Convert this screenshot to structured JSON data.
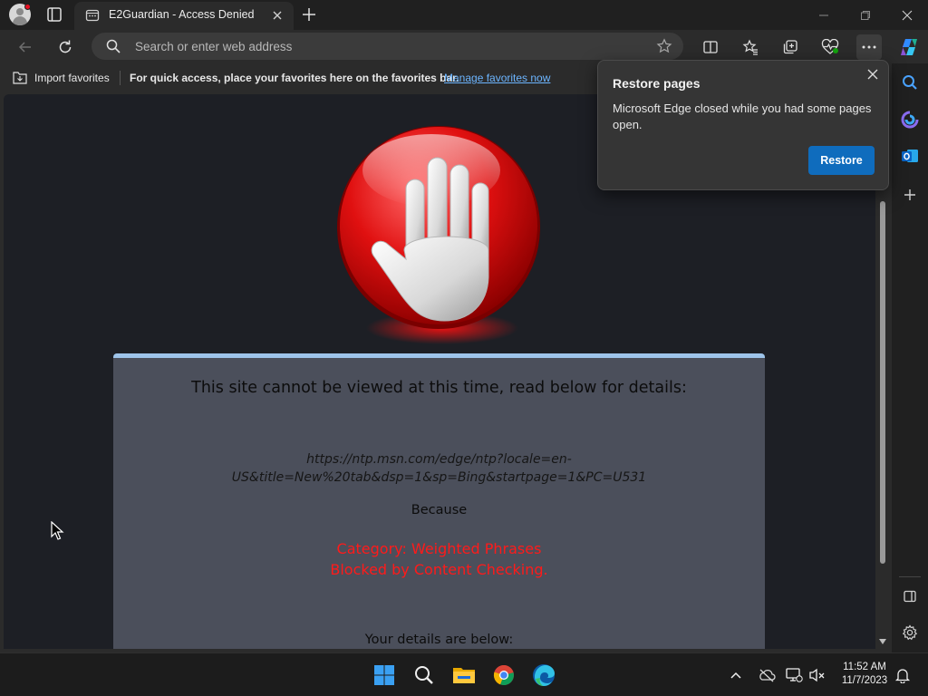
{
  "browser": {
    "tab_title": "E2Guardian - Access Denied",
    "address_placeholder": "Search or enter web address",
    "favorites_bar": {
      "import_label": "Import favorites",
      "hint_text": "For quick access, place your favorites here on the favorites bar.",
      "manage_link": "Manage favorites now"
    }
  },
  "popup": {
    "title": "Restore pages",
    "body": "Microsoft Edge closed while you had some pages open.",
    "button": "Restore"
  },
  "page": {
    "heading": "This site cannot be viewed at this time, read below for details:",
    "blocked_url": "https://ntp.msn.com/edge/ntp?locale=en-US&title=New%20tab&dsp=1&sp=Bing&startpage=1&PC=U531",
    "because_label": "Because",
    "category_line": "Category: Weighted Phrases",
    "reason_line": "Blocked by Content Checking.",
    "details_label": "Your details are below:"
  },
  "taskbar": {
    "time": "11:52 AM",
    "date": "11/7/2023",
    "apps": [
      "start-icon",
      "search-icon",
      "file-explorer-icon",
      "chrome-icon",
      "edge-icon"
    ]
  },
  "colors": {
    "accent_blue": "#0f6cbd",
    "block_red": "#ff1a1a",
    "card_bg": "#4b4f5b",
    "page_bg": "#1d1f25"
  }
}
